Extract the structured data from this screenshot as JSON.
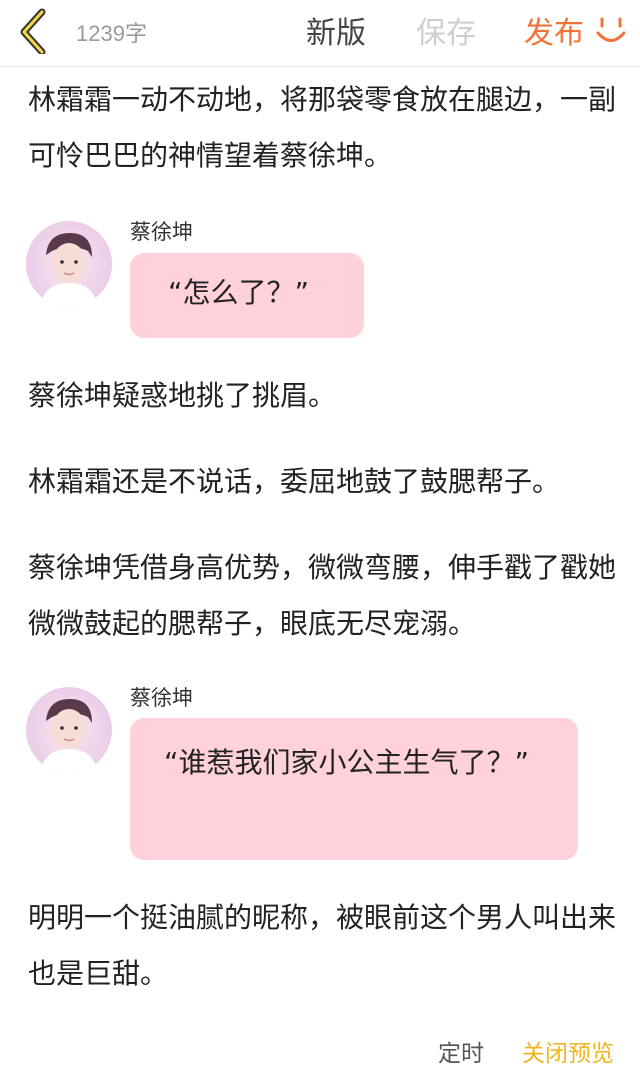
{
  "header": {
    "word_count": "1239字",
    "new_label": "新版",
    "save_label": "保存",
    "publish_label": "发布"
  },
  "article": {
    "para1": "林霜霜一动不动地，将那袋零食放在腿边，一副可怜巴巴的神情望着蔡徐坤。",
    "chat1": {
      "speaker": "蔡徐坤",
      "text": "“怎么了？”"
    },
    "para2": "蔡徐坤疑惑地挑了挑眉。",
    "para3": "林霜霜还是不说话，委屈地鼓了鼓腮帮子。",
    "para4": "蔡徐坤凭借身高优势，微微弯腰，伸手戳了戳她微微鼓起的腮帮子，眼底无尽宠溺。",
    "chat2": {
      "speaker": "蔡徐坤",
      "text": "“谁惹我们家小公主生气了？”"
    },
    "para5": "明明一个挺油腻的昵称，被眼前这个男人叫出来也是巨甜。"
  },
  "footer": {
    "timer_label": "定时",
    "close_preview_label": "关闭预览"
  },
  "colors": {
    "accent_orange": "#f2733a",
    "accent_yellow": "#f0b41d",
    "bubble_pink": "#ffd1da"
  },
  "icons": {
    "back": "chevron-left-icon",
    "smile": "smile-icon"
  }
}
